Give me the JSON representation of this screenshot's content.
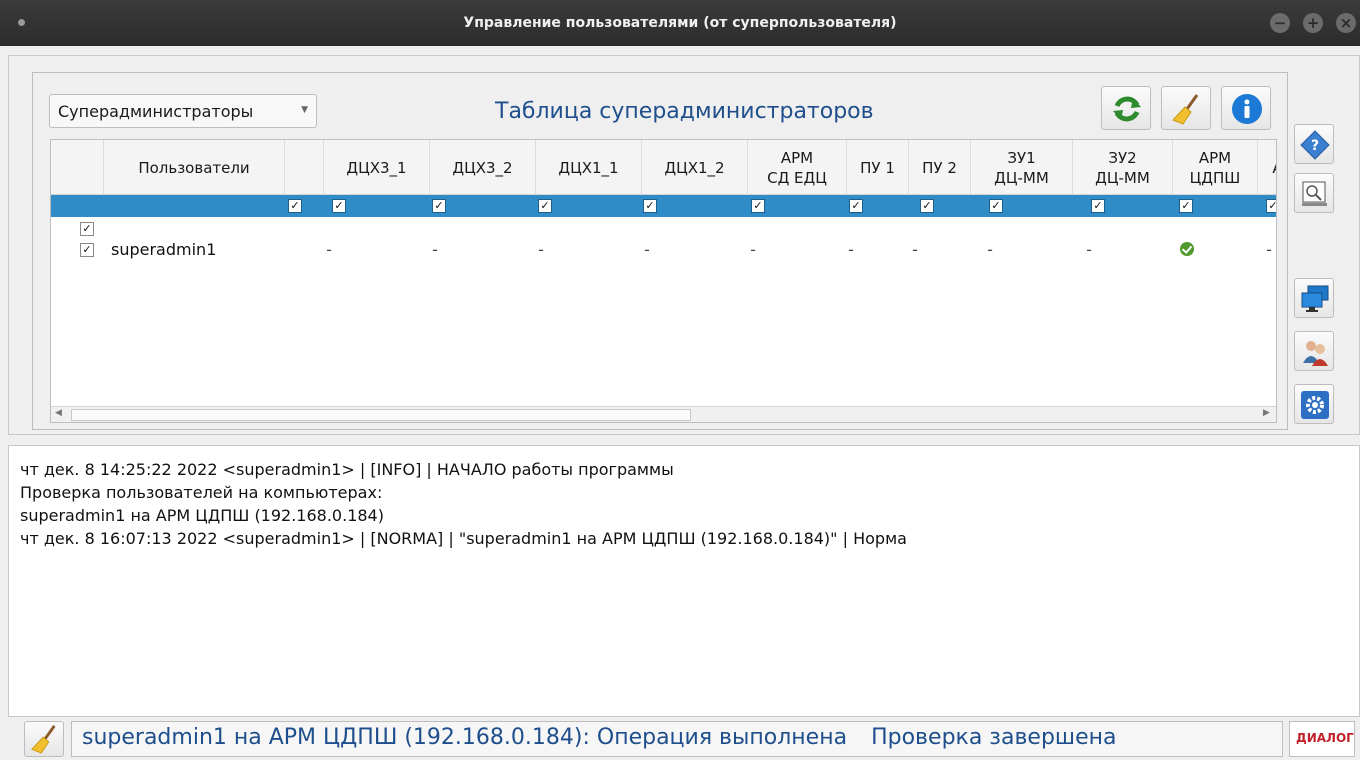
{
  "window": {
    "title": "Управление пользователями (от суперпользователя)"
  },
  "panel": {
    "group_select": "Супeрадминистраторы",
    "table_title": "Таблица суперадминистраторов"
  },
  "toolbar": {
    "icons": [
      "refresh-icon",
      "broom-icon",
      "info-icon"
    ]
  },
  "table": {
    "columns": [
      {
        "label": ""
      },
      {
        "label": "Пользователи"
      },
      {
        "label": ""
      },
      {
        "label": "ДЦХ3_1"
      },
      {
        "label": "ДЦХ3_2"
      },
      {
        "label": "ДЦХ1_1"
      },
      {
        "label": "ДЦХ1_2"
      },
      {
        "label": "АРМ\nСД ЕДЦ"
      },
      {
        "label": "ПУ 1"
      },
      {
        "label": "ПУ 2"
      },
      {
        "label": "ЗУ1\nДЦ-ММ"
      },
      {
        "label": "ЗУ2\nДЦ-ММ"
      },
      {
        "label": "АРМ\nЦДПШ"
      },
      {
        "label": "А"
      }
    ],
    "rows": [
      {
        "checked": true,
        "user": "",
        "cells": [
          "",
          "",
          "",
          "",
          "",
          "",
          "",
          "",
          "",
          "",
          ""
        ]
      },
      {
        "checked": true,
        "user": "superadmin1",
        "cells": [
          "-",
          "-",
          "-",
          "-",
          "-",
          "-",
          "-",
          "-",
          "-",
          "ok",
          "-"
        ]
      }
    ]
  },
  "side_buttons": [
    "help-icon",
    "search-computer-icon",
    "computers-icon",
    "users-icon",
    "settings-icon"
  ],
  "log": {
    "lines": [
      "чт дек. 8 14:25:22 2022 <superadmin1> | [INFO] | НАЧАЛО работы программы",
      "Проверка пользователей на компьютерах:",
      "superadmin1 на АРМ ЦДПШ (192.168.0.184)",
      "чт дек. 8 16:07:13 2022 <superadmin1> | [NORMA] | \"superadmin1 на АРМ ЦДПШ (192.168.0.184)\" | Норма"
    ]
  },
  "status": {
    "message": "superadmin1 на АРМ ЦДПШ (192.168.0.184): Операция выполнена",
    "result": "Проверка завершена",
    "logo": "ДИАЛОГ"
  },
  "colors": {
    "accent_blue": "#1e4f8c",
    "selection": "#308cc6",
    "ok_green": "#4f9a2a"
  }
}
